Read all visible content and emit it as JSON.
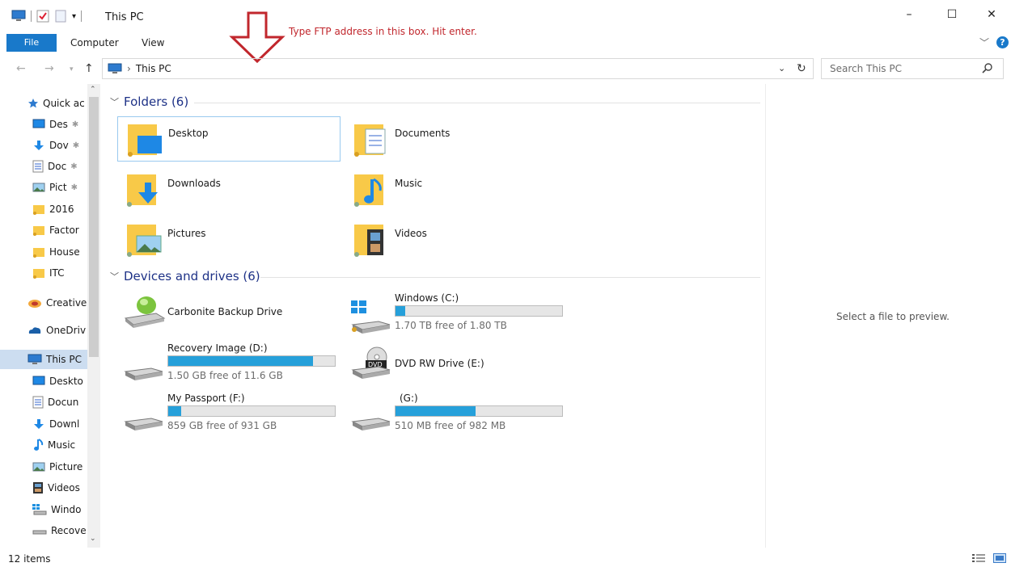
{
  "window": {
    "title": "This PC",
    "minimize": "–",
    "maximize": "☐",
    "close": "✕"
  },
  "ribbon": {
    "file_tab": "File",
    "tabs": [
      "Computer",
      "View"
    ],
    "help": "?"
  },
  "annotation": {
    "text": "Type FTP address in this box. Hit enter."
  },
  "address": {
    "path": "This PC",
    "search_placeholder": "Search This PC"
  },
  "sidebar": {
    "items": [
      {
        "label": "Quick ac",
        "icon": "star-icon"
      },
      {
        "label": "Des",
        "icon": "desktop-icon",
        "pinned": true
      },
      {
        "label": "Dov",
        "icon": "downloads-icon",
        "pinned": true
      },
      {
        "label": "Doc",
        "icon": "documents-icon",
        "pinned": true
      },
      {
        "label": "Pict",
        "icon": "pictures-icon",
        "pinned": true
      },
      {
        "label": "2016",
        "icon": "folder-icon"
      },
      {
        "label": "Factor",
        "icon": "folder-icon"
      },
      {
        "label": "House",
        "icon": "folder-icon"
      },
      {
        "label": "ITC",
        "icon": "folder-icon"
      },
      {
        "label": "Creative",
        "icon": "creative-cloud-icon"
      },
      {
        "label": "OneDriv",
        "icon": "onedrive-icon"
      },
      {
        "label": "This PC",
        "icon": "computer-icon"
      },
      {
        "label": "Deskto",
        "icon": "desktop-icon"
      },
      {
        "label": "Docun",
        "icon": "documents-icon"
      },
      {
        "label": "Downl",
        "icon": "downloads-icon"
      },
      {
        "label": "Music",
        "icon": "music-icon"
      },
      {
        "label": "Picture",
        "icon": "pictures-icon"
      },
      {
        "label": "Videos",
        "icon": "videos-icon"
      },
      {
        "label": "Windo",
        "icon": "windows-drive-icon"
      },
      {
        "label": "Recove",
        "icon": "drive-icon"
      }
    ]
  },
  "folders": {
    "heading": "Folders (6)",
    "items": [
      {
        "label": "Desktop"
      },
      {
        "label": "Documents"
      },
      {
        "label": "Downloads"
      },
      {
        "label": "Music"
      },
      {
        "label": "Pictures"
      },
      {
        "label": "Videos"
      }
    ]
  },
  "drives": {
    "heading": "Devices and drives (6)",
    "items": [
      {
        "name": "Carbonite Backup Drive",
        "free": ""
      },
      {
        "name": "Windows (C:)",
        "free": "1.70 TB free of 1.80 TB",
        "used_fraction": 0.06
      },
      {
        "name": "Recovery Image (D:)",
        "free": "1.50 GB free of 11.6 GB",
        "used_fraction": 0.87
      },
      {
        "name": "DVD RW Drive (E:)",
        "free": ""
      },
      {
        "name": "My Passport (F:)",
        "free": "859 GB free of 931 GB",
        "used_fraction": 0.08
      },
      {
        "name": "(G:)",
        "free": "510 MB free of 982 MB",
        "used_fraction": 0.48
      }
    ]
  },
  "preview": {
    "text": "Select a file to preview."
  },
  "status": {
    "count": "12 items"
  },
  "colors": {
    "accent": "#1979ca",
    "drive_fill": "#26a0da",
    "annotation": "#c1272d",
    "folder": "#f8c948"
  }
}
